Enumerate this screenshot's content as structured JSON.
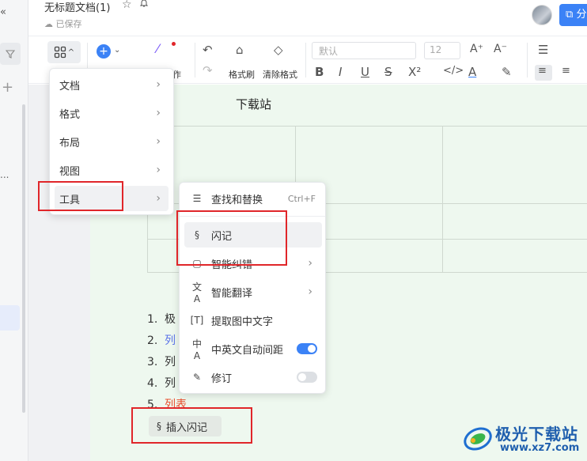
{
  "header": {
    "doc_title": "无标题文档(1)",
    "saved_status": "已保存",
    "share_label": "分"
  },
  "rail": {
    "collapse_icon": "«",
    "ellipsis": "..."
  },
  "toolbar": {
    "insert_cut_label": "作",
    "format_painter_label": "格式刷",
    "clear_format_label": "清除格式",
    "font_placeholder": "默认",
    "font_size": "12"
  },
  "document": {
    "heading_fragment": "下载站",
    "list": [
      {
        "num": "1.",
        "text": "极",
        "color": "#333333"
      },
      {
        "num": "2.",
        "text": "列",
        "color": "#5b73e8"
      },
      {
        "num": "3.",
        "text": "列",
        "color": "#333333"
      },
      {
        "num": "4.",
        "text": "列",
        "color": "#333333"
      },
      {
        "num": "5.",
        "text": "列表",
        "color": "#e8502f"
      }
    ]
  },
  "main_menu": {
    "items": [
      {
        "label": "文档"
      },
      {
        "label": "格式"
      },
      {
        "label": "布局"
      },
      {
        "label": "视图"
      },
      {
        "label": "工具"
      }
    ]
  },
  "tools_submenu": {
    "find_replace": {
      "label": "查找和替换",
      "shortcut": "Ctrl+F"
    },
    "flash_note": {
      "label": "闪记"
    },
    "smart_correct": {
      "label": "智能纠错"
    },
    "smart_translate": {
      "label": "智能翻译"
    },
    "extract_text": {
      "label": "提取图中文字"
    },
    "auto_spacing": {
      "label": "中英文自动间距",
      "enabled": true
    },
    "revision": {
      "label": "修订",
      "enabled": false
    }
  },
  "insert_flash_note": {
    "label": "插入闪记"
  },
  "watermark": {
    "title": "极光下载站",
    "url": "www.xz7.com"
  },
  "colors": {
    "accent": "#3b82f6",
    "highlight_box": "#e0262a",
    "page_bg": "#eef8ef"
  }
}
